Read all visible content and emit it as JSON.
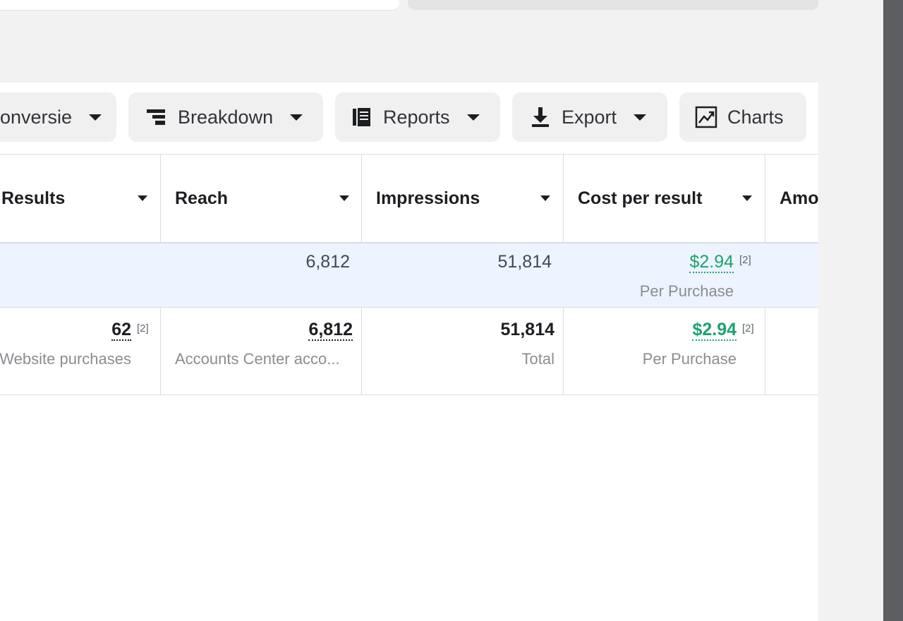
{
  "toolbar": {
    "conversie_label": "onversie",
    "breakdown_label": "Breakdown",
    "reports_label": "Reports",
    "export_label": "Export",
    "charts_label": "Charts"
  },
  "table": {
    "columns": [
      "Results",
      "Reach",
      "Impressions",
      "Cost per result",
      "Amo"
    ],
    "summary_row": {
      "reach": "6,812",
      "impressions": "51,814",
      "cost": "$2.94",
      "cost_note": "[2]",
      "cost_sub": "Per Purchase"
    },
    "data_row": {
      "results": "62",
      "results_note": "[2]",
      "results_sub": "Website purchases",
      "reach": "6,812",
      "reach_sub": "Accounts Center acco...",
      "impressions": "51,814",
      "impressions_sub": "Total",
      "cost": "$2.94",
      "cost_note": "[2]",
      "cost_sub": "Per Purchase"
    }
  },
  "colors": {
    "accent_green": "#1da36e",
    "row_highlight": "#edf3ff"
  },
  "icons": [
    "caret-down-icon",
    "breakdown-icon",
    "reports-icon",
    "download-icon",
    "chart-icon",
    "sort-caret-icon"
  ]
}
